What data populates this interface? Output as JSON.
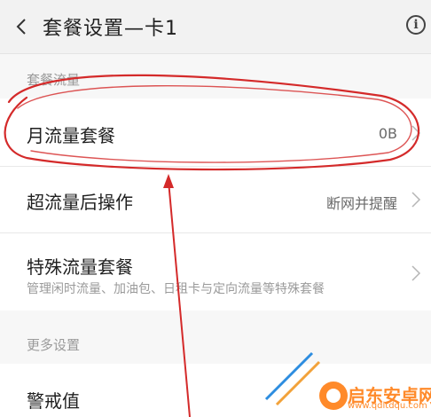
{
  "header": {
    "title": "套餐设置—卡1",
    "back_icon": "chevron-left-icon",
    "info_icon": "info-icon",
    "info_glyph": "i"
  },
  "sections": [
    {
      "label": "套餐流量",
      "items": [
        {
          "label": "月流量套餐",
          "value": "0B"
        },
        {
          "label": "超流量后操作",
          "value": "断网并提醒"
        },
        {
          "label": "特殊流量套餐",
          "sub": "管理闲时流量、加油包、日租卡与定向流量等特殊套餐"
        }
      ]
    },
    {
      "label": "更多设置",
      "items": [
        {
          "label": "警戒值"
        }
      ]
    }
  ],
  "annotation": {
    "color": "#d42a2a"
  },
  "watermark": {
    "text": "启东安卓网",
    "url": "www.qdltdqu.com",
    "color": "#ff8a2a"
  }
}
